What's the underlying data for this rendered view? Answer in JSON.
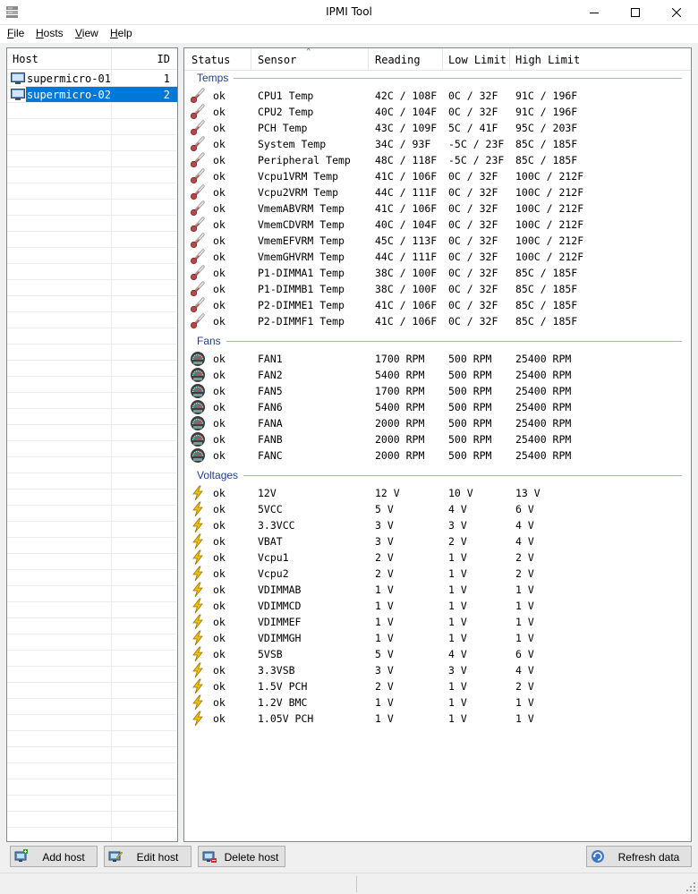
{
  "window": {
    "title": "IPMI Tool",
    "app_icon": "server-rack-icon"
  },
  "menu": [
    {
      "label": "File",
      "accel": "F",
      "rest": "ile"
    },
    {
      "label": "Hosts",
      "accel": "H",
      "rest": "osts"
    },
    {
      "label": "View",
      "accel": "V",
      "rest": "iew"
    },
    {
      "label": "Help",
      "accel": "H",
      "rest": "elp"
    }
  ],
  "hosts": {
    "columns": {
      "host": "Host",
      "id": "ID"
    },
    "rows": [
      {
        "name": "supermicro-01",
        "id": "1",
        "selected": false
      },
      {
        "name": "supermicro-02",
        "id": "2",
        "selected": true
      }
    ]
  },
  "sensors": {
    "columns": {
      "status": "Status",
      "sensor": "Sensor",
      "reading": "Reading",
      "low": "Low Limit",
      "high": "High Limit"
    },
    "groups": [
      {
        "name": "Temps",
        "icon": "thermometer-icon",
        "rows": [
          {
            "status": "ok",
            "sensor": "CPU1 Temp",
            "reading": "42C / 108F",
            "low": "0C / 32F",
            "high": "91C / 196F"
          },
          {
            "status": "ok",
            "sensor": "CPU2 Temp",
            "reading": "40C / 104F",
            "low": "0C / 32F",
            "high": "91C / 196F"
          },
          {
            "status": "ok",
            "sensor": "PCH Temp",
            "reading": "43C / 109F",
            "low": "5C / 41F",
            "high": "95C / 203F"
          },
          {
            "status": "ok",
            "sensor": "System Temp",
            "reading": "34C / 93F",
            "low": "-5C / 23F",
            "high": "85C / 185F"
          },
          {
            "status": "ok",
            "sensor": "Peripheral Temp",
            "reading": "48C / 118F",
            "low": "-5C / 23F",
            "high": "85C / 185F"
          },
          {
            "status": "ok",
            "sensor": "Vcpu1VRM Temp",
            "reading": "41C / 106F",
            "low": "0C / 32F",
            "high": "100C / 212F"
          },
          {
            "status": "ok",
            "sensor": "Vcpu2VRM Temp",
            "reading": "44C / 111F",
            "low": "0C / 32F",
            "high": "100C / 212F"
          },
          {
            "status": "ok",
            "sensor": "VmemABVRM Temp",
            "reading": "41C / 106F",
            "low": "0C / 32F",
            "high": "100C / 212F"
          },
          {
            "status": "ok",
            "sensor": "VmemCDVRM Temp",
            "reading": "40C / 104F",
            "low": "0C / 32F",
            "high": "100C / 212F"
          },
          {
            "status": "ok",
            "sensor": "VmemEFVRM Temp",
            "reading": "45C / 113F",
            "low": "0C / 32F",
            "high": "100C / 212F"
          },
          {
            "status": "ok",
            "sensor": "VmemGHVRM Temp",
            "reading": "44C / 111F",
            "low": "0C / 32F",
            "high": "100C / 212F"
          },
          {
            "status": "ok",
            "sensor": "P1-DIMMA1 Temp",
            "reading": "38C / 100F",
            "low": "0C / 32F",
            "high": "85C / 185F"
          },
          {
            "status": "ok",
            "sensor": "P1-DIMMB1 Temp",
            "reading": "38C / 100F",
            "low": "0C / 32F",
            "high": "85C / 185F"
          },
          {
            "status": "ok",
            "sensor": "P2-DIMME1 Temp",
            "reading": "41C / 106F",
            "low": "0C / 32F",
            "high": "85C / 185F"
          },
          {
            "status": "ok",
            "sensor": "P2-DIMMF1 Temp",
            "reading": "41C / 106F",
            "low": "0C / 32F",
            "high": "85C / 185F"
          }
        ]
      },
      {
        "name": "Fans",
        "icon": "fan-gauge-icon",
        "rows": [
          {
            "status": "ok",
            "sensor": "FAN1",
            "reading": "1700 RPM",
            "low": "500 RPM",
            "high": "25400 RPM"
          },
          {
            "status": "ok",
            "sensor": "FAN2",
            "reading": "5400 RPM",
            "low": "500 RPM",
            "high": "25400 RPM"
          },
          {
            "status": "ok",
            "sensor": "FAN5",
            "reading": "1700 RPM",
            "low": "500 RPM",
            "high": "25400 RPM"
          },
          {
            "status": "ok",
            "sensor": "FAN6",
            "reading": "5400 RPM",
            "low": "500 RPM",
            "high": "25400 RPM"
          },
          {
            "status": "ok",
            "sensor": "FANA",
            "reading": "2000 RPM",
            "low": "500 RPM",
            "high": "25400 RPM"
          },
          {
            "status": "ok",
            "sensor": "FANB",
            "reading": "2000 RPM",
            "low": "500 RPM",
            "high": "25400 RPM"
          },
          {
            "status": "ok",
            "sensor": "FANC",
            "reading": "2000 RPM",
            "low": "500 RPM",
            "high": "25400 RPM"
          }
        ]
      },
      {
        "name": "Voltages",
        "icon": "lightning-icon",
        "rows": [
          {
            "status": "ok",
            "sensor": "12V",
            "reading": "12 V",
            "low": "10 V",
            "high": "13 V"
          },
          {
            "status": "ok",
            "sensor": "5VCC",
            "reading": "5 V",
            "low": "4 V",
            "high": "6 V"
          },
          {
            "status": "ok",
            "sensor": "3.3VCC",
            "reading": "3 V",
            "low": "3 V",
            "high": "4 V"
          },
          {
            "status": "ok",
            "sensor": "VBAT",
            "reading": "3 V",
            "low": "2 V",
            "high": "4 V"
          },
          {
            "status": "ok",
            "sensor": "Vcpu1",
            "reading": "2 V",
            "low": "1 V",
            "high": "2 V"
          },
          {
            "status": "ok",
            "sensor": "Vcpu2",
            "reading": "2 V",
            "low": "1 V",
            "high": "2 V"
          },
          {
            "status": "ok",
            "sensor": "VDIMMAB",
            "reading": "1 V",
            "low": "1 V",
            "high": "1 V"
          },
          {
            "status": "ok",
            "sensor": "VDIMMCD",
            "reading": "1 V",
            "low": "1 V",
            "high": "1 V"
          },
          {
            "status": "ok",
            "sensor": "VDIMMEF",
            "reading": "1 V",
            "low": "1 V",
            "high": "1 V"
          },
          {
            "status": "ok",
            "sensor": "VDIMMGH",
            "reading": "1 V",
            "low": "1 V",
            "high": "1 V"
          },
          {
            "status": "ok",
            "sensor": "5VSB",
            "reading": "5 V",
            "low": "4 V",
            "high": "6 V"
          },
          {
            "status": "ok",
            "sensor": "3.3VSB",
            "reading": "3 V",
            "low": "3 V",
            "high": "4 V"
          },
          {
            "status": "ok",
            "sensor": "1.5V PCH",
            "reading": "2 V",
            "low": "1 V",
            "high": "2 V"
          },
          {
            "status": "ok",
            "sensor": "1.2V BMC",
            "reading": "1 V",
            "low": "1 V",
            "high": "1 V"
          },
          {
            "status": "ok",
            "sensor": "1.05V PCH",
            "reading": "1 V",
            "low": "1 V",
            "high": "1 V"
          }
        ]
      }
    ]
  },
  "buttons": {
    "add_host": "Add host",
    "edit_host": "Edit host",
    "delete_host": "Delete host",
    "refresh": "Refresh data"
  },
  "colors": {
    "accent": "#0078d7",
    "group_header": "#1e3f95",
    "thermo": "#b84848",
    "lightning": "#f2c200"
  }
}
